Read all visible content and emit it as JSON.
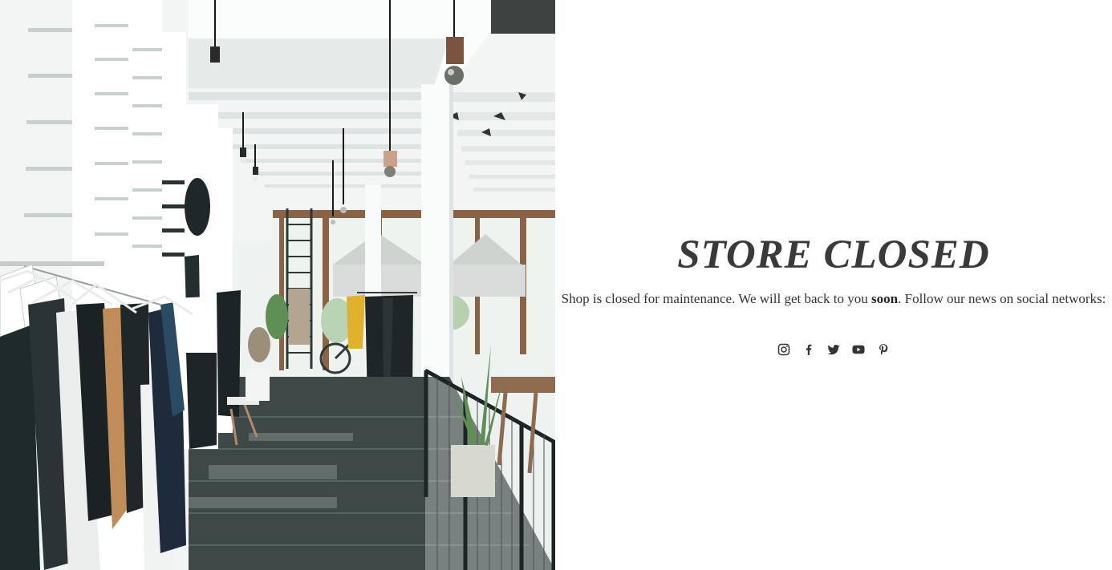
{
  "hero_image": {
    "alt": "",
    "colors": {
      "ceiling": "#f4f6f5",
      "floor": "#3b4645",
      "wood": "#8a6244",
      "dark_garment": "#1e2628",
      "mustard_garment": "#c08d5a",
      "yellow_jacket": "#e0b12a",
      "plant": "#5f8f55"
    }
  },
  "store": {
    "title": "STORE CLOSED",
    "message_before": "Shop is closed for maintenance. We will get back to you ",
    "message_bold": "soon",
    "message_after": ". Follow our news on social networks:"
  },
  "socials": [
    {
      "name": "instagram-icon"
    },
    {
      "name": "facebook-icon"
    },
    {
      "name": "twitter-icon"
    },
    {
      "name": "youtube-icon"
    },
    {
      "name": "pinterest-icon"
    }
  ],
  "colors": {
    "title": "#3a3a3a",
    "text": "#333333",
    "icon": "#333333",
    "background": "#ffffff"
  }
}
